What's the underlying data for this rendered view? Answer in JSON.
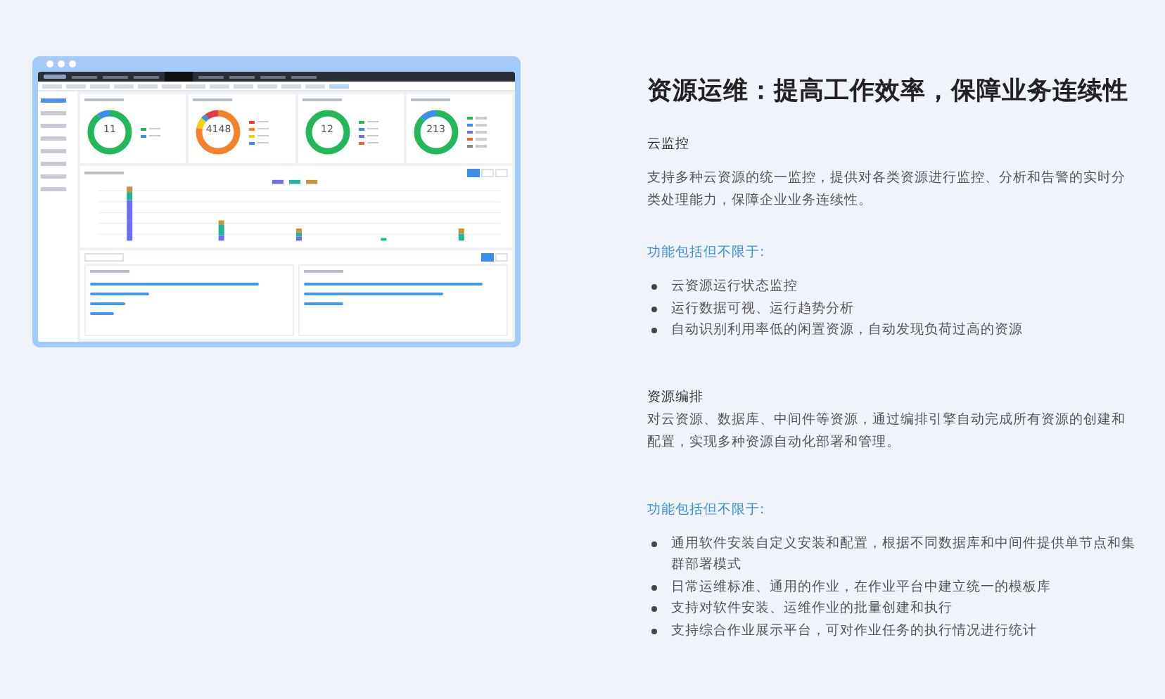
{
  "screenshot": {
    "kind": "dashboard",
    "nav_tabs": [
      {
        "selected": false
      },
      {
        "selected": false
      },
      {
        "selected": false
      },
      {
        "selected": true
      },
      {
        "selected": false
      },
      {
        "selected": false
      },
      {
        "selected": false
      },
      {
        "selected": false
      }
    ],
    "page_tabs": [
      {
        "selected": false
      },
      {
        "selected": false
      },
      {
        "selected": false
      },
      {
        "selected": false
      },
      {
        "selected": false
      },
      {
        "selected": false
      },
      {
        "selected": false
      },
      {
        "selected": false
      },
      {
        "selected": false
      },
      {
        "selected": false
      },
      {
        "selected": false
      },
      {
        "selected": false
      },
      {
        "selected": true
      }
    ],
    "sidebar_items": [
      {
        "selected": true
      },
      {
        "selected": false
      },
      {
        "selected": false
      },
      {
        "selected": false
      },
      {
        "selected": false
      },
      {
        "selected": false
      },
      {
        "selected": false
      },
      {
        "selected": false
      }
    ],
    "donut_cards": [
      {
        "center": "11"
      },
      {
        "center": "4148"
      },
      {
        "center": "12"
      },
      {
        "center": "213"
      }
    ]
  },
  "title": "资源运维：提高工作效率，保障业务连续性",
  "sections": [
    {
      "heading": "云监控",
      "description": "支持多种云资源的统一监控，提供对各类资源进行监控、分析和告警的实时分类处理能力，保障企业业务连续性。",
      "features_label": "功能包括但不限于:",
      "features": [
        "云资源运行状态监控",
        "运行数据可视、运行趋势分析",
        "自动识别利用率低的闲置资源，自动发现负荷过高的资源"
      ]
    },
    {
      "heading": "资源编排",
      "description": "对云资源、数据库、中间件等资源，通过编排引擎自动完成所有资源的创建和配置，实现多种资源自动化部署和管理。",
      "features_label": "功能包括但不限于:",
      "features": [
        "通用软件安装自定义安装和配置，根据不同数据库和中间件提供单节点和集群部署模式",
        "日常运维标准、通用的作业，在作业平台中建立统一的模板库",
        "支持对软件安装、运维作业的批量创建和执行",
        "支持综合作业展示平台，可对作业任务的执行情况进行统计"
      ]
    }
  ]
}
